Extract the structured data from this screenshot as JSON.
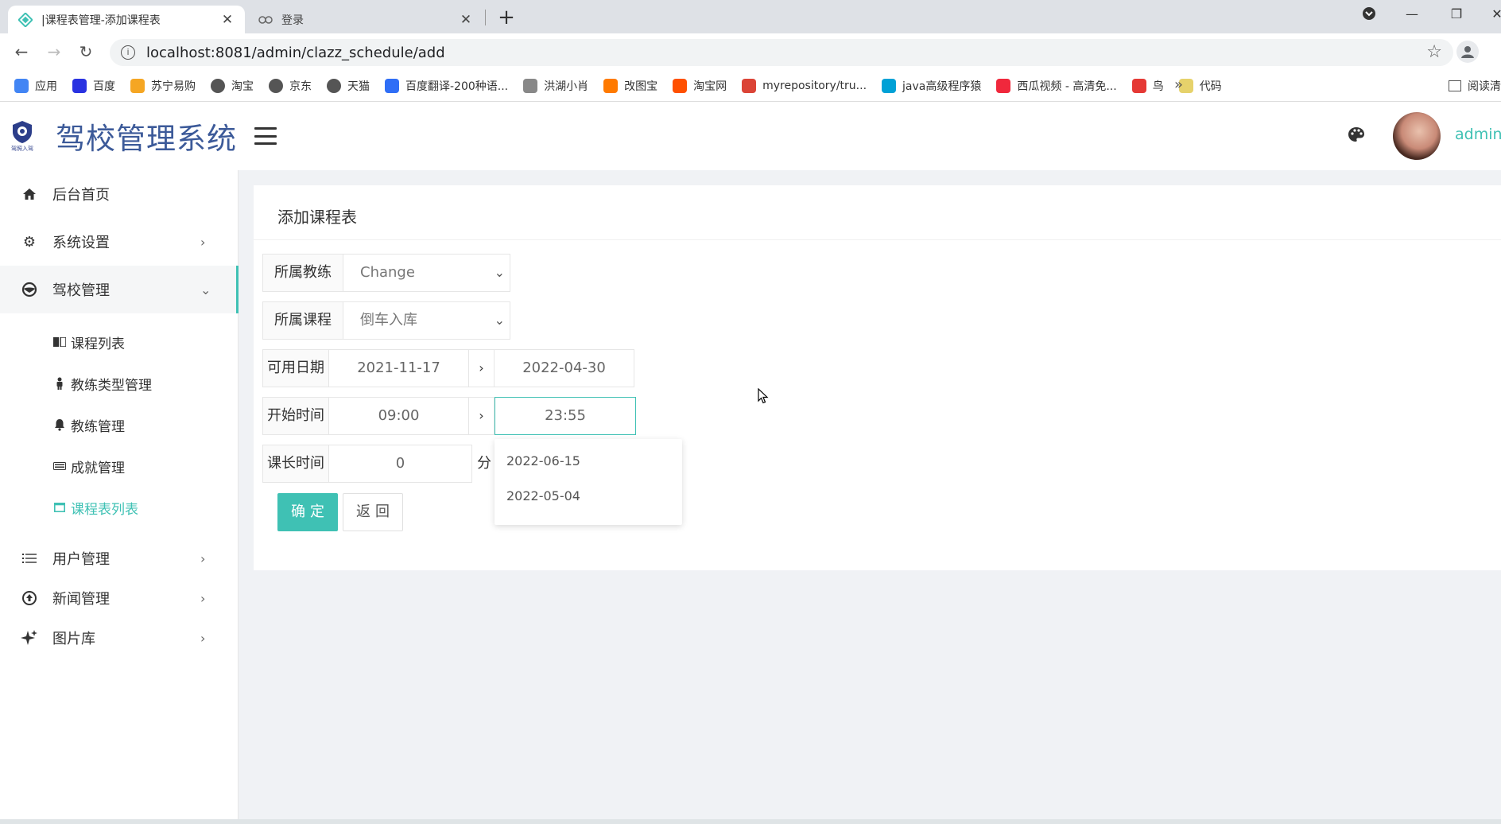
{
  "browser": {
    "active_tab_title": "|课程表管理-添加课程表",
    "inactive_tab_title": "登录",
    "new_tab_symbol": "+",
    "url": "localhost:8081/admin/clazz_schedule/add",
    "bookmarks": [
      {
        "label": "应用",
        "icon": "apps-grid-icon",
        "color": "#4285f4"
      },
      {
        "label": "百度",
        "icon": "baidu-paw-icon",
        "color": "#2932e1"
      },
      {
        "label": "苏宁易购",
        "icon": "suning-icon",
        "color": "#f5a623"
      },
      {
        "label": "淘宝",
        "icon": "globe-icon",
        "color": "#555555"
      },
      {
        "label": "京东",
        "icon": "globe-icon",
        "color": "#555555"
      },
      {
        "label": "天猫",
        "icon": "globe-icon",
        "color": "#555555"
      },
      {
        "label": "百度翻译-200种语...",
        "icon": "translate-icon",
        "color": "#2f6ef6"
      },
      {
        "label": "洪湖小肖",
        "icon": "bird-icon",
        "color": "#888888"
      },
      {
        "label": "改图宝",
        "icon": "gaitubao-icon",
        "color": "#ff7a00"
      },
      {
        "label": "淘宝网",
        "icon": "taobao-icon",
        "color": "#ff5000"
      },
      {
        "label": "myrepository/tru...",
        "icon": "chrome-icon",
        "color": "#db4437"
      },
      {
        "label": "java高级程序猿",
        "icon": "bilibili-icon",
        "color": "#00a1d6"
      },
      {
        "label": "西瓜视频 - 高清免...",
        "icon": "xigua-icon",
        "color": "#f0283c"
      },
      {
        "label": "鸟",
        "icon": "bird-red-icon",
        "color": "#e53935"
      },
      {
        "label": "代码",
        "icon": "moon-icon",
        "color": "#e6d26b"
      }
    ],
    "bookmarks_more": "»",
    "reading_list": "阅读清"
  },
  "app": {
    "logo_text": "驾校管理系统",
    "logo_caption": "驾照入驾",
    "user_name": "admin"
  },
  "sidebar": {
    "items": [
      {
        "label": "后台首页",
        "icon": "home-icon"
      },
      {
        "label": "系统设置",
        "icon": "gear-icon",
        "arrow": "›"
      },
      {
        "label": "驾校管理",
        "icon": "steering-wheel-icon",
        "arrow": "⌄"
      },
      {
        "label": "用户管理",
        "icon": "list-icon",
        "arrow": "›"
      },
      {
        "label": "新闻管理",
        "icon": "upload-circle-icon",
        "arrow": "›"
      },
      {
        "label": "图片库",
        "icon": "sparkle-icon",
        "arrow": "›"
      }
    ],
    "sub_items": [
      {
        "label": "课程列表",
        "icon": "book-icon"
      },
      {
        "label": "教练类型管理",
        "icon": "person-icon"
      },
      {
        "label": "教练管理",
        "icon": "bell-icon"
      },
      {
        "label": "成就管理",
        "icon": "keyboard-icon"
      },
      {
        "label": "课程表列表",
        "icon": "window-icon"
      }
    ]
  },
  "form": {
    "title": "添加课程表",
    "coach_label": "所属教练",
    "coach_value": "Change",
    "course_label": "所属课程",
    "course_value": "倒车入库",
    "date_label": "可用日期",
    "date_start": "2021-11-17",
    "date_end": "2022-04-30",
    "time_label": "开始时间",
    "time_start": "09:00",
    "time_end": "23:55",
    "duration_label": "课长时间",
    "duration_value": "0",
    "duration_unit": "分钟",
    "range_sep": "›",
    "autocomplete": [
      "2022-06-15",
      "2022-05-04"
    ],
    "submit_label": "确定",
    "back_label": "返回"
  }
}
